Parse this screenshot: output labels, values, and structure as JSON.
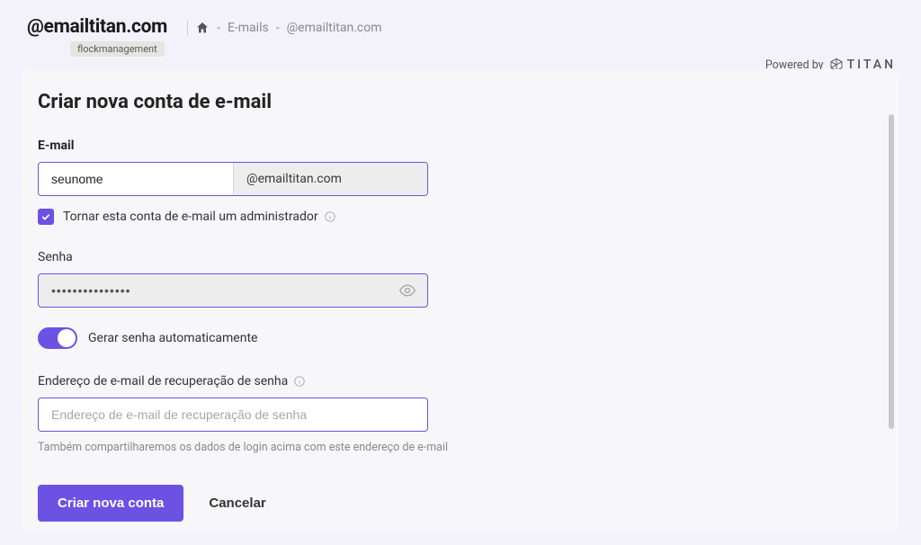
{
  "header": {
    "domain": "@emailtitan.com",
    "tag": "flockmanagement",
    "breadcrumb": {
      "sep1": " - ",
      "emails": "E-mails",
      "sep2": " - ",
      "current": "@emailtitan.com"
    },
    "powered_by": "Powered by",
    "titan": "TITAN"
  },
  "form": {
    "title": "Criar nova conta de e-mail",
    "email_label": "E-mail",
    "email_value": "seunome",
    "email_suffix": "@emailtitan.com",
    "admin_label": "Tornar esta conta de e-mail um administrador",
    "password_label": "Senha",
    "password_value": "•••••••••••••••",
    "auto_pw_label": "Gerar senha automaticamente",
    "recovery_label": "Endereço de e-mail de recuperação de senha",
    "recovery_placeholder": "Endereço de e-mail de recuperação de senha",
    "recovery_hint": "Também compartilharemos os dados de login acima com este endereço de e-mail",
    "submit": "Criar nova conta",
    "cancel": "Cancelar"
  }
}
